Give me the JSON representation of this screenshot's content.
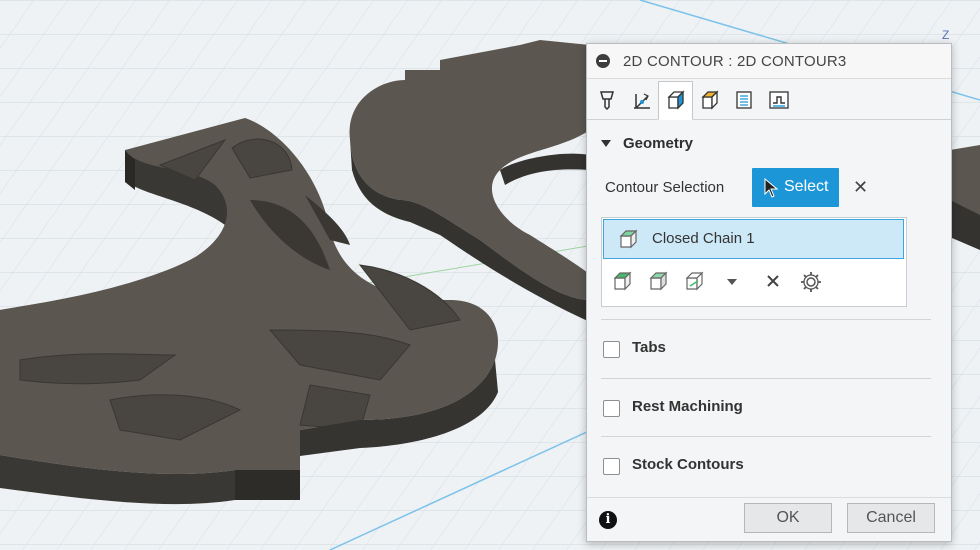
{
  "viewport": {
    "axis_label": "Z"
  },
  "dialog": {
    "title": "2D CONTOUR : 2D CONTOUR3",
    "tabs": [
      {
        "name": "tool-tab"
      },
      {
        "name": "heights-tab"
      },
      {
        "name": "geometry-tab"
      },
      {
        "name": "passes-tab"
      },
      {
        "name": "linking-tab"
      },
      {
        "name": "simulation-tab"
      }
    ],
    "geometry": {
      "label": "Geometry",
      "contour_selection_label": "Contour Selection",
      "select_label": "Select",
      "chains": [
        "Closed Chain 1"
      ]
    },
    "options": {
      "tabs": "Tabs",
      "rest_machining": "Rest Machining",
      "stock_contours": "Stock Contours"
    },
    "buttons": {
      "ok": "OK",
      "cancel": "Cancel"
    },
    "colors": {
      "accent": "#1d96d8",
      "selection": "#cde8f7",
      "model": "#5b5650"
    }
  }
}
